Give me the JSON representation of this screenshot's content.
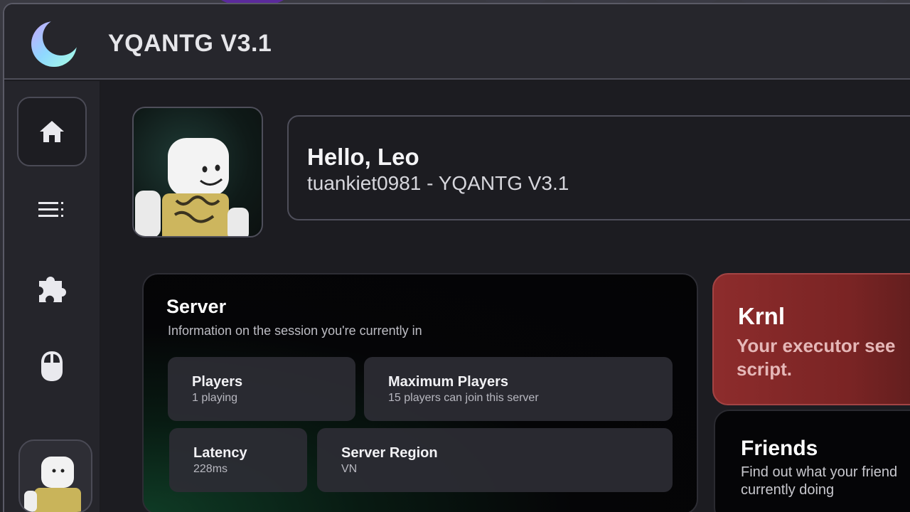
{
  "app": {
    "title": "YQANTG V3.1"
  },
  "sidebar": {
    "items": [
      {
        "icon": "home-icon"
      },
      {
        "icon": "list-icon"
      },
      {
        "icon": "puzzle-icon"
      },
      {
        "icon": "mouse-icon"
      }
    ]
  },
  "profile": {
    "greeting": "Hello, Leo",
    "subtitle": "tuankiet0981 - YQANTG V3.1"
  },
  "server": {
    "title": "Server",
    "description": "Information on the session you're currently in",
    "stats": {
      "players": {
        "label": "Players",
        "value": "1 playing"
      },
      "max_players": {
        "label": "Maximum Players",
        "value": "15 players can join this server"
      },
      "latency": {
        "label": "Latency",
        "value": "228ms"
      },
      "region": {
        "label": "Server Region",
        "value": "VN"
      }
    }
  },
  "krnl": {
    "title": "Krnl",
    "description_line1": "Your executor see",
    "description_line2": "script."
  },
  "friends": {
    "title": "Friends",
    "description_line1": "Find out what your friend",
    "description_line2": "currently doing"
  },
  "colors": {
    "accent_red": "#8d2c2c",
    "accent_green": "#0f3b25",
    "panel": "#1b1b20"
  }
}
